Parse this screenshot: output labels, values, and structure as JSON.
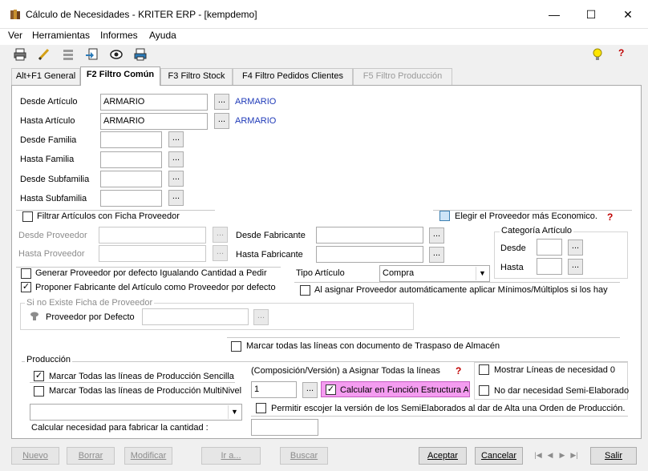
{
  "window": {
    "title": "Cálculo de Necesidades - KRITER ERP - [kempdemo]",
    "minimize": "—",
    "maximize": "☐",
    "close": "✕"
  },
  "menu": [
    "Ver",
    "Herramientas",
    "Informes",
    "Ayuda"
  ],
  "toolbar_icons": [
    "print-icon",
    "pencil-icon",
    "list-icon",
    "export-icon",
    "view-icon",
    "printer-icon",
    "lightbulb-icon",
    "help-icon"
  ],
  "tabs": [
    {
      "label": "Alt+F1 General",
      "state": "normal"
    },
    {
      "label": "F2 Filtro Común",
      "state": "active"
    },
    {
      "label": "F3 Filtro Stock",
      "state": "normal"
    },
    {
      "label": "F4 Filtro Pedidos Clientes",
      "state": "normal"
    },
    {
      "label": "F5 Filtro Producción",
      "state": "disabled"
    }
  ],
  "filters": {
    "desde_articulo": {
      "label": "Desde Artículo",
      "value": "ARMARIO",
      "desc": "ARMARIO"
    },
    "hasta_articulo": {
      "label": "Hasta Artículo",
      "value": "ARMARIO",
      "desc": "ARMARIO"
    },
    "desde_familia": {
      "label": "Desde Familia",
      "value": ""
    },
    "hasta_familia": {
      "label": "Hasta Familia",
      "value": ""
    },
    "desde_subfamilia": {
      "label": "Desde Subfamilia",
      "value": ""
    },
    "hasta_subfamilia": {
      "label": "Hasta Subfamilia",
      "value": ""
    },
    "dots": "..."
  },
  "ficha_proveedor": {
    "label": "Filtrar Artículos con Ficha Proveedor",
    "checked": false
  },
  "elegir_proveedor": {
    "label": "Elegir el Proveedor más Economico.",
    "checked": false
  },
  "proveedor": {
    "desde_label": "Desde Proveedor",
    "hasta_label": "Hasta Proveedor",
    "desde_fab_label": "Desde Fabricante",
    "hasta_fab_label": "Hasta Fabricante"
  },
  "categoria": {
    "title": "Categoría Artículo",
    "desde_label": "Desde",
    "hasta_label": "Hasta"
  },
  "generar_proveedor": {
    "label": "Generar Proveedor por defecto Igualando Cantidad a Pedir",
    "checked": false
  },
  "proponer_fabricante": {
    "label": "Proponer Fabricante del Artículo como Proveedor por defecto",
    "checked": true
  },
  "tipo_articulo": {
    "label": "Tipo Artículo",
    "value": "Compra"
  },
  "minimos_multiplos": {
    "label": "Al asignar Proveedor automáticamente aplicar Mínimos/Múltiplos si los hay",
    "checked": false
  },
  "ficha_group": {
    "title": "Si no Existe Ficha de Proveedor",
    "label": "Proveedor por Defecto"
  },
  "traspaso": {
    "label": "Marcar todas las líneas con documento de Traspaso de Almacén",
    "checked": false
  },
  "produccion": {
    "title": "Producción",
    "sencilla": {
      "label": "Marcar Todas las líneas de Producción Sencilla",
      "checked": true
    },
    "multinivel": {
      "label": "Marcar Todas las líneas de Producción MultiNivel",
      "checked": false
    },
    "comp_version_label": "(Composición/Versión) a Asignar Todas la líneas",
    "comp_version_value": "1",
    "estructura": {
      "label": "Calcular en Función Estructura Ar",
      "checked": true
    },
    "mostrar_necesidad": {
      "label": "Mostrar Líneas de necesidad 0",
      "checked": false
    },
    "semi_elaborado": {
      "label": "No dar necesidad Semi-Elaborado",
      "checked": false
    },
    "permitir_version": {
      "label": "Permitir escojer la versión de los SemiElaborados al dar de Alta una Orden de Producción.",
      "checked": false
    },
    "calcular_label": "Calcular necesidad para fabricar la cantidad :"
  },
  "buttons": {
    "nuevo": "Nuevo",
    "borrar": "Borrar",
    "modificar": "Modificar",
    "ir_a": "Ir a...",
    "buscar": "Buscar",
    "aceptar": "Aceptar",
    "cancelar": "Cancelar",
    "salir": "Salir"
  },
  "colors": {
    "link": "#1f3ab8",
    "highlight": "#f49cf0",
    "help": "#c00000"
  }
}
